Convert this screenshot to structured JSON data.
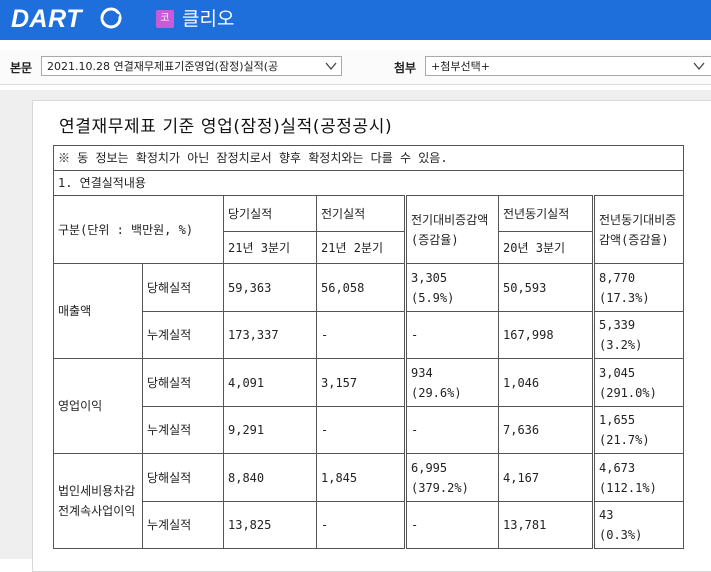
{
  "header": {
    "logo": "DART",
    "company_badge": "코",
    "company_name": "클리오"
  },
  "selectors": {
    "main_label": "본문",
    "main_value": "2021.10.28  연결재무제표기준영업(잠정)실적(공",
    "attach_label": "첨부",
    "attach_value": "+첨부선택+"
  },
  "document": {
    "title": "연결재무제표 기준 영업(잠정)실적(공정공시)",
    "note": "※ 동 정보는 확정치가 아닌 잠정치로서 향후 확정치와는 다를 수 있음.",
    "section": "1. 연결실적내용",
    "table": {
      "unit_header": "구분(단위 : 백만원, %)",
      "col_current": "당기실적",
      "col_current_period": "21년 3분기",
      "col_prev": "전기실적",
      "col_prev_period": "21년 2분기",
      "col_qoq": "전기대비증감액(증감율)",
      "col_yoy_base": "전년동기실적",
      "col_yoy_base_period": "20년 3분기",
      "col_yoy": "전년동기대비증감액(증감율)",
      "groups": [
        {
          "name": "매출액",
          "rows": [
            {
              "type": "당해실적",
              "current": "59,363",
              "prev": "56,058",
              "qoq_amt": "3,305",
              "qoq_rate": "(5.9%)",
              "yoy_base": "50,593",
              "yoy_amt": "8,770",
              "yoy_rate": "(17.3%)"
            },
            {
              "type": "누계실적",
              "current": "173,337",
              "prev": "-",
              "qoq_amt": "-",
              "qoq_rate": "",
              "yoy_base": "167,998",
              "yoy_amt": "5,339",
              "yoy_rate": "(3.2%)"
            }
          ]
        },
        {
          "name": "영업이익",
          "rows": [
            {
              "type": "당해실적",
              "current": "4,091",
              "prev": "3,157",
              "qoq_amt": "934",
              "qoq_rate": "(29.6%)",
              "yoy_base": "1,046",
              "yoy_amt": "3,045",
              "yoy_rate": "(291.0%)"
            },
            {
              "type": "누계실적",
              "current": "9,291",
              "prev": "-",
              "qoq_amt": "-",
              "qoq_rate": "",
              "yoy_base": "7,636",
              "yoy_amt": "1,655",
              "yoy_rate": "(21.7%)"
            }
          ]
        },
        {
          "name": "법인세비용차감전계속사업이익",
          "rows": [
            {
              "type": "당해실적",
              "current": "8,840",
              "prev": "1,845",
              "qoq_amt": "6,995",
              "qoq_rate": "(379.2%)",
              "yoy_base": "4,167",
              "yoy_amt": "4,673",
              "yoy_rate": "(112.1%)"
            },
            {
              "type": "누계실적",
              "current": "13,825",
              "prev": "-",
              "qoq_amt": "-",
              "qoq_rate": "",
              "yoy_base": "13,781",
              "yoy_amt": "43",
              "yoy_rate": "(0.3%)"
            }
          ]
        }
      ]
    }
  },
  "colors": {
    "topbar": "#1e6fdb",
    "badge": "#c85bd8"
  }
}
